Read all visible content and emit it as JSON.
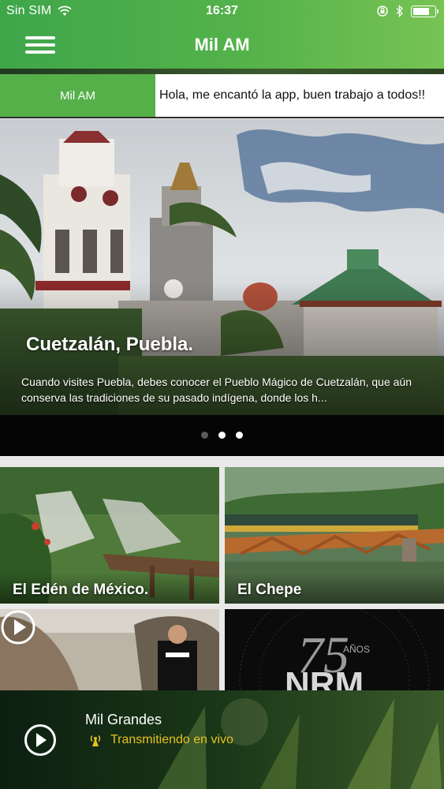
{
  "status_bar": {
    "carrier": "Sin SIM",
    "time": "16:37",
    "battery_level": 0.75
  },
  "nav": {
    "title": "Mil AM",
    "menu_icon": "hamburger-menu-icon"
  },
  "ticker": {
    "tab_label": "Mil AM",
    "message": "Hola, me encantó la app, buen trabajo a todos!!"
  },
  "hero": {
    "title": "Cuetzalán, Puebla.",
    "description": "Cuando visites Puebla, debes conocer el Pueblo Mágico de Cuetzalán, que aún conserva las tradiciones de su pasado indígena, donde los h...",
    "pages": 3,
    "active_page": 2
  },
  "grid": {
    "cards": [
      {
        "label": "El Edén de México."
      },
      {
        "label": "El Chepe"
      },
      {
        "label": ""
      },
      {
        "label": ""
      }
    ]
  },
  "player": {
    "title": "Mil Grandes",
    "status": "Transmitiendo en vivo",
    "status_color": "#e8c020"
  },
  "colors": {
    "brand_green": "#55b04a",
    "header_gradient_start": "#3fa64a",
    "header_gradient_end": "#77c354"
  }
}
